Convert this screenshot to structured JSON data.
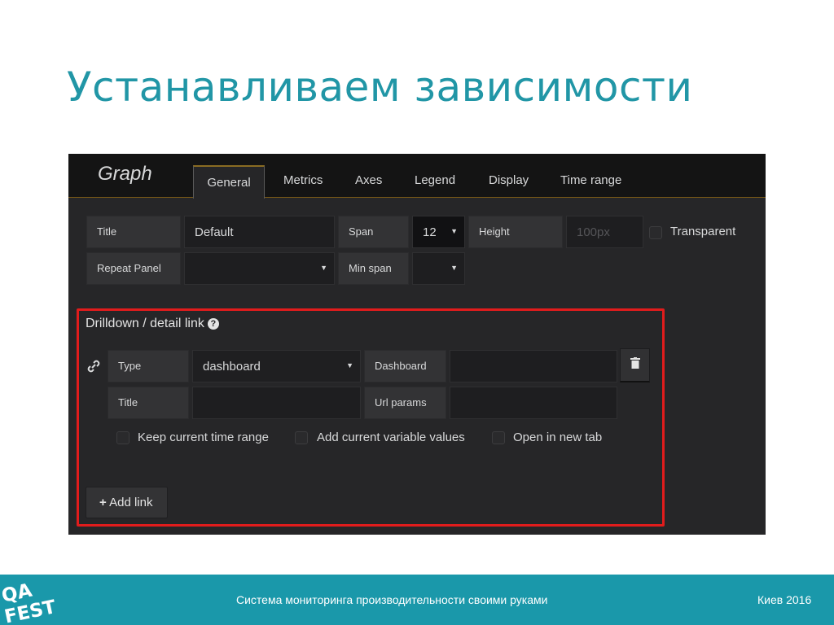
{
  "slide": {
    "title": "Устанавливаем зависимости"
  },
  "panel_editor": {
    "title": "Graph",
    "tabs": [
      {
        "label": "General",
        "active": true
      },
      {
        "label": "Metrics",
        "active": false
      },
      {
        "label": "Axes",
        "active": false
      },
      {
        "label": "Legend",
        "active": false
      },
      {
        "label": "Display",
        "active": false
      },
      {
        "label": "Time range",
        "active": false
      }
    ],
    "general": {
      "title_label": "Title",
      "title_value": "Default",
      "span_label": "Span",
      "span_value": "12",
      "height_label": "Height",
      "height_placeholder": "100px",
      "transparent_label": "Transparent",
      "repeat_panel_label": "Repeat Panel",
      "repeat_panel_value": "",
      "min_span_label": "Min span",
      "min_span_value": ""
    },
    "drilldown": {
      "section_title": "Drilldown / detail link",
      "help_icon": "question-circle-icon",
      "link_icon": "chain-link-icon",
      "type_label": "Type",
      "type_value": "dashboard",
      "dashboard_label": "Dashboard",
      "dashboard_value": "",
      "title_label": "Title",
      "title_value": "",
      "url_params_label": "Url params",
      "url_params_value": "",
      "keep_time_label": "Keep current time range",
      "add_vars_label": "Add current variable values",
      "new_tab_label": "Open in new tab",
      "add_link_label": "Add link",
      "add_link_icon": "+",
      "trash_icon": "trash-icon"
    },
    "highlight_color": "#e11c1c"
  },
  "footer": {
    "logo_text_line1": "QA",
    "logo_text_line2": "FEST",
    "center_text": "Система мониторинга производительности своими руками",
    "right_text": "Киев 2016",
    "background": "#1a98aa"
  }
}
